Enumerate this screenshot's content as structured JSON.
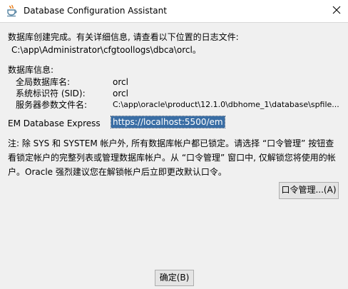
{
  "window": {
    "title": "Database Configuration Assistant"
  },
  "message": {
    "line1": "数据库创建完成。有关详细信息, 请查看以下位置的日志文件:",
    "log_path": "C:\\app\\Administrator\\cfgtoollogs\\dbca\\orcl。"
  },
  "db_info": {
    "heading": "数据库信息:",
    "rows": [
      {
        "label": "全局数据库名:",
        "value": "orcl"
      },
      {
        "label": "系统标识符 (SID):",
        "value": "orcl"
      },
      {
        "label": "服务器参数文件名:",
        "value": "C:\\app\\oracle\\product\\12.1.0\\dbhome_1\\database\\spfile..."
      }
    ]
  },
  "em": {
    "label": "EM Database Express",
    "url": "https://localhost:5500/em"
  },
  "note": {
    "line1": "注: 除 SYS 和 SYSTEM 帐户外, 所有数据库帐户都已锁定。请选择 “口令管理” 按钮查",
    "line2": "看锁定帐户的完整列表或管理数据库帐户。从 “口令管理” 窗口中, 仅解锁您将使用的帐",
    "line3": "户。Oracle 强烈建议您在解锁帐户后立即更改默认口令。"
  },
  "buttons": {
    "password_mgmt": "口令管理...(A)",
    "ok": "确定(B)"
  },
  "icons": {
    "app": "java-cup-icon",
    "close": "close-icon"
  }
}
